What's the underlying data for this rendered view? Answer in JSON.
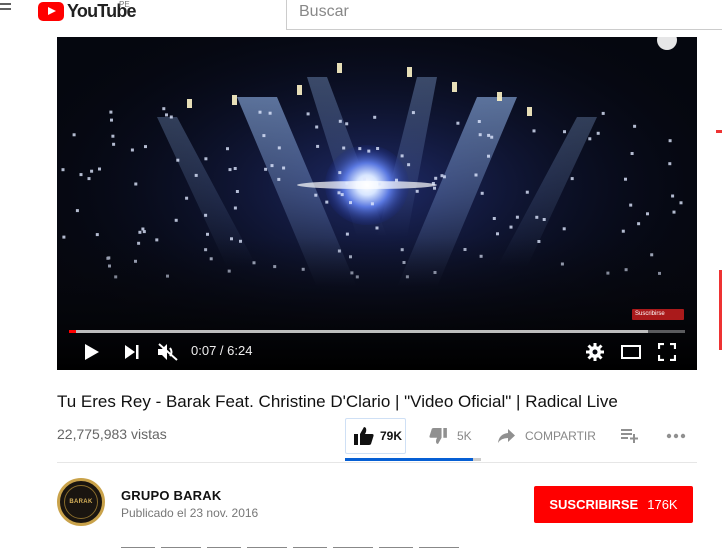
{
  "masthead": {
    "logo_text": "YouTube",
    "region": "PE",
    "search_placeholder": "Buscar"
  },
  "player": {
    "time_current": "0:07",
    "time_separator": " / ",
    "time_total": "6:24",
    "progress_played_fraction": 0.011,
    "progress_loaded_fraction": 0.94,
    "watermark_text": "Suscribirse"
  },
  "video": {
    "title": "Tu Eres Rey - Barak Feat. Christine D'Clario | \"Video Oficial\" | Radical Live",
    "views": "22,775,983 vistas",
    "likes": "79K",
    "dislikes": "5K",
    "share_label": "COMPARTIR",
    "like_ratio_fraction": 0.94
  },
  "channel": {
    "name": "GRUPO BARAK",
    "published": "Publicado el 23 nov. 2016",
    "avatar_text": "BARAK",
    "subscribe_label": "SUSCRIBIRSE",
    "subscriber_count": "176K"
  },
  "colors": {
    "brand_red": "#ff0000",
    "accent_blue": "#065fd4"
  },
  "icons": [
    "menu-icon",
    "play-icon",
    "next-icon",
    "mute-icon",
    "settings-icon",
    "theater-icon",
    "fullscreen-icon",
    "thumbs-up-icon",
    "thumbs-down-icon",
    "share-icon",
    "add-to-playlist-icon",
    "more-icon"
  ]
}
